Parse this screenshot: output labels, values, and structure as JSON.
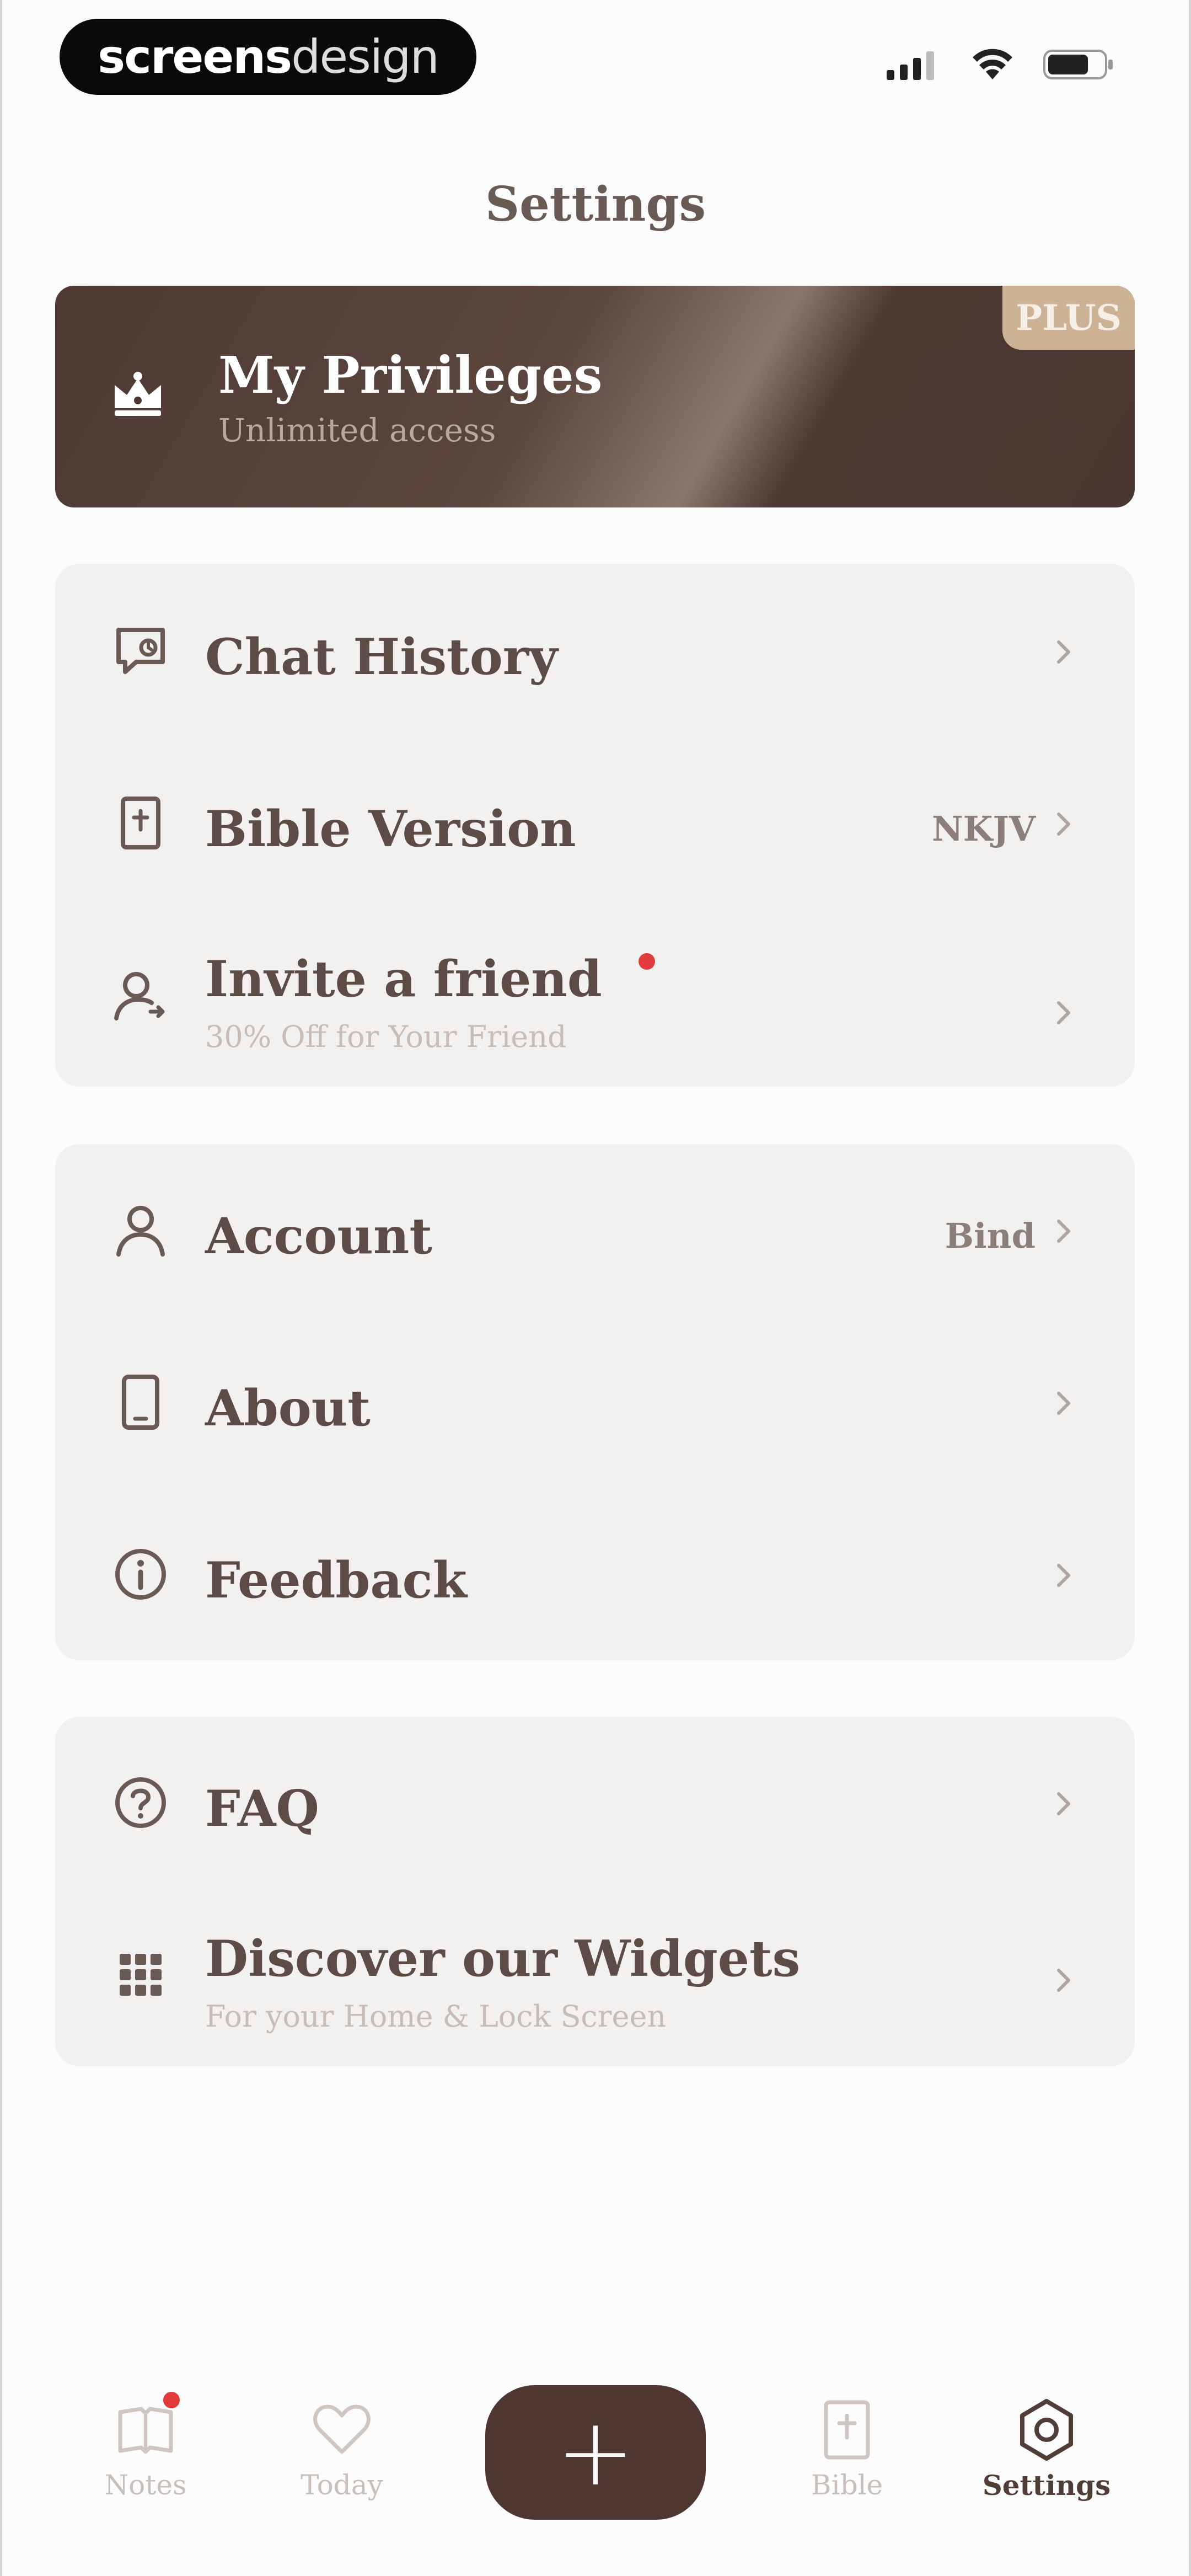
{
  "status_bar": {
    "logo_bold": "screens",
    "logo_light": "design",
    "signal_icon": "signal-icon",
    "wifi_icon": "wifi-icon",
    "battery_icon": "battery-icon"
  },
  "header": {
    "title": "Settings"
  },
  "privileges": {
    "title": "My Privileges",
    "subtitle": "Unlimited access",
    "badge": "PLUS",
    "icon": "crown-icon"
  },
  "groups": [
    {
      "items": [
        {
          "label": "Chat History",
          "icon": "chat-history-icon"
        },
        {
          "label": "Bible Version",
          "value": "NKJV",
          "icon": "bible-icon"
        },
        {
          "label": "Invite a friend",
          "subtitle": "30% Off for Your Friend",
          "icon": "invite-friend-icon",
          "has_dot": true
        }
      ]
    },
    {
      "items": [
        {
          "label": "Account",
          "value": "Bind",
          "icon": "account-icon"
        },
        {
          "label": "About",
          "icon": "about-icon"
        },
        {
          "label": "Feedback",
          "icon": "feedback-icon"
        }
      ]
    },
    {
      "items": [
        {
          "label": "FAQ",
          "icon": "faq-icon"
        },
        {
          "label": "Discover our Widgets",
          "subtitle": "For your Home & Lock Screen",
          "icon": "widgets-icon"
        }
      ]
    }
  ],
  "tabbar": {
    "tabs": [
      {
        "label": "Notes",
        "icon": "notes-icon",
        "has_dot": true
      },
      {
        "label": "Today",
        "icon": "heart-icon"
      },
      {
        "label": "Bible",
        "icon": "bible-tab-icon"
      },
      {
        "label": "Settings",
        "icon": "settings-icon",
        "active": true
      }
    ],
    "add_label": "+"
  },
  "colors": {
    "brand_brown": "#4d3730",
    "plus_gold": "#cdb296",
    "group_bg": "#f3f0f0",
    "text_primary": "#5d4c45",
    "notification_red": "#e23b3b"
  }
}
